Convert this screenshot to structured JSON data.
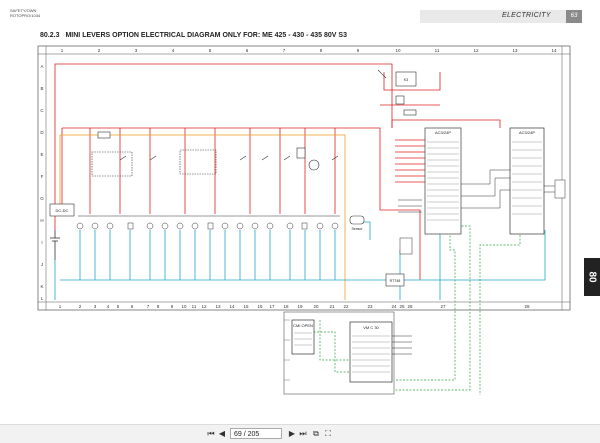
{
  "header": {
    "left_line1": "SAFETY/OWN",
    "left_line2": "ROTOPRO/1034",
    "section": "ELECTRICITY",
    "page_badge": "63"
  },
  "title": {
    "number": "80.2.3",
    "text": "MINI LEVERS OPTION ELECTRICAL DIAGRAM ONLY FOR: ME 425 - 430 - 435 80V S3"
  },
  "side_tab": "80",
  "diagram": {
    "row_letters": [
      "A",
      "B",
      "C",
      "D",
      "E",
      "F",
      "G",
      "H",
      "I",
      "J",
      "K",
      "L"
    ],
    "top_columns": [
      "1",
      "2",
      "3",
      "4",
      "5",
      "6",
      "7",
      "8",
      "9",
      "10",
      "11",
      "12",
      "13",
      "14"
    ],
    "bottom_numbers": [
      "1",
      "2",
      "3",
      "4",
      "5",
      "6",
      "7",
      "8",
      "9",
      "10",
      "11",
      "12",
      "13",
      "14",
      "15",
      "16",
      "17",
      "18",
      "19",
      "20",
      "21",
      "22",
      "23",
      "24",
      "25",
      "26",
      "27",
      "28"
    ],
    "labels": {
      "dcdc": "DC-DC",
      "ac1": "AC3/24P",
      "ac2": "AC3/24P",
      "cmi": "CMI OPEN",
      "vmc": "VM C 30",
      "relay": "K3",
      "sensor": "Sensor",
      "module": "RTT48"
    }
  },
  "toolbar": {
    "page_value": "69 / 205",
    "icons": [
      "first-page-icon",
      "prev-page-icon",
      "next-page-icon",
      "last-page-icon",
      "fit-page-icon",
      "fullscreen-icon"
    ]
  }
}
